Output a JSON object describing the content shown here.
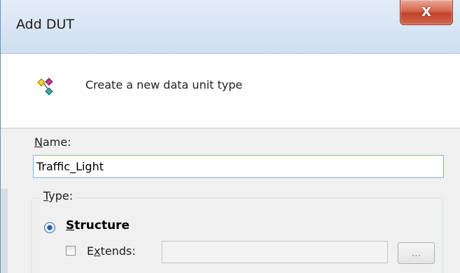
{
  "window": {
    "title": "Add DUT",
    "close_label": "X"
  },
  "header": {
    "icon": "dut-icon",
    "text": "Create a new data unit type"
  },
  "name": {
    "label_accel": "N",
    "label_rest": "ame:",
    "value": "Traffic_Light"
  },
  "type": {
    "label_accel": "T",
    "label_rest": "ype:",
    "structure_accel": "S",
    "structure_rest": "tructure",
    "structure_selected": true,
    "extends_pre": "E",
    "extends_accel": "x",
    "extends_rest": "tends:",
    "extends_checked": false,
    "extends_value": "",
    "browse_label": "..."
  }
}
